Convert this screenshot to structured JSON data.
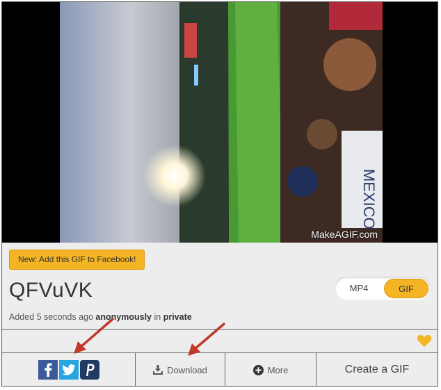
{
  "video": {
    "watermark": "MakeAGIF.com"
  },
  "promo": {
    "label": "New: Add this GIF to Facebook!"
  },
  "gif": {
    "title": "QFVuVK",
    "added_prefix": "Added ",
    "added_time": "5 seconds ago",
    "added_by_word": "anonymously",
    "added_in": " in ",
    "added_privacy": "private"
  },
  "format_toggle": {
    "mp4_label": "MP4",
    "gif_label": "GIF",
    "selected": "GIF"
  },
  "actions": {
    "download_label": "Download",
    "more_label": "More",
    "create_label": "Create a GIF",
    "share_icons": [
      "facebook-icon",
      "twitter-icon",
      "pinterest-icon"
    ]
  },
  "colors": {
    "accent": "#f4b424",
    "facebook": "#3b5a98",
    "twitter": "#2aa4e0",
    "pinterest": "#1f3a63",
    "arrow": "#c0392b"
  }
}
